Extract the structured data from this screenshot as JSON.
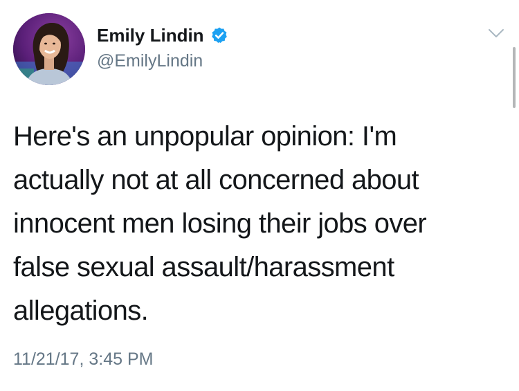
{
  "tweet": {
    "author": {
      "display_name": "Emily Lindin",
      "handle": "@EmilyLindin",
      "verified": true,
      "verified_icon": "verified-badge-icon",
      "verified_color": "#1da1f2"
    },
    "text_lines": [
      "Here's an unpopular opinion: I'm",
      "actually not at all concerned about",
      "innocent men losing their jobs over",
      "false sexual assault/harassment",
      "allegations."
    ],
    "timestamp": "11/21/17, 3:45 PM",
    "menu_icon": "chevron-down-icon"
  },
  "colors": {
    "text_primary": "#14171a",
    "text_secondary": "#657786",
    "accent": "#1da1f2"
  }
}
